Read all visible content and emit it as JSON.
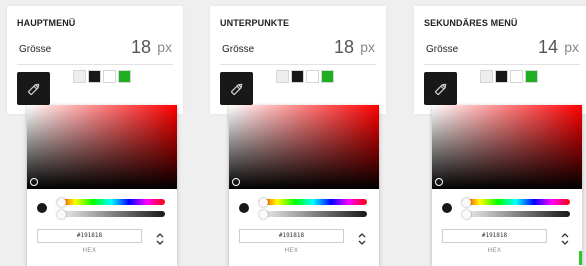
{
  "panels": [
    {
      "title": "HAUPTMENÜ",
      "size_label": "Grösse",
      "size_value": "18",
      "size_unit": "px",
      "hex_value": "#191818",
      "format_label": "HEX"
    },
    {
      "title": "UNTERPUNKTE",
      "size_label": "Grösse",
      "size_value": "18",
      "size_unit": "px",
      "hex_value": "#191818",
      "format_label": "HEX"
    },
    {
      "title": "SEKUNDÄRES MENÜ",
      "size_label": "Grösse",
      "size_value": "14",
      "size_unit": "px",
      "hex_value": "#191818",
      "format_label": "HEX"
    }
  ],
  "swatch_colors": [
    "#eeeeee",
    "#191818",
    "#ffffff",
    "#1fae1f"
  ],
  "picker": {
    "hue_color": "#ff0000",
    "selected_color": "#191818",
    "hue_fraction": 0.0,
    "alpha_fraction": 0.0
  },
  "icons": {
    "edit": "pencil-icon",
    "toggle": "up-down-chevron-icon"
  }
}
